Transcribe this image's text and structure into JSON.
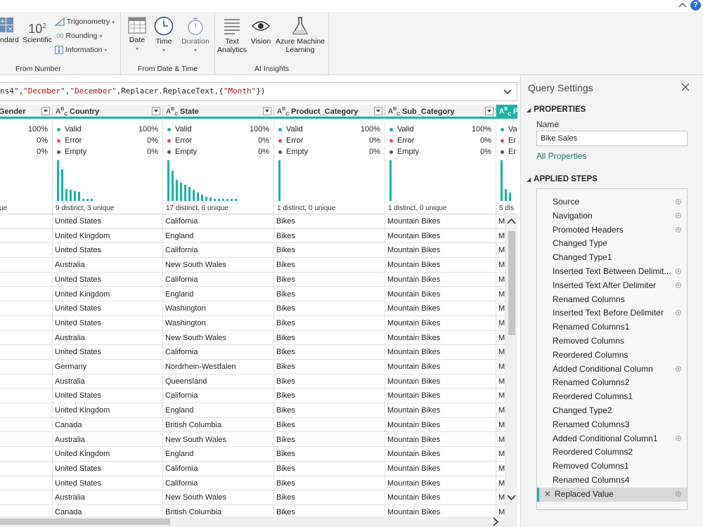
{
  "ribbon": {
    "from_number": {
      "standard_label": "ndard",
      "scientific_label": "Scientific",
      "ten_base": "10",
      "ten_exp": "2",
      "trig_label": "Trigonometry",
      "rounding_label": "Rounding",
      "information_label": "Information",
      "group_label": "From Number"
    },
    "from_date_time": {
      "date_label": "Date",
      "time_label": "Time",
      "duration_label": "Duration",
      "group_label": "From Date & Time"
    },
    "ai_insights": {
      "text_label_1": "Text",
      "text_label_2": "Analytics",
      "vision_label": "Vision",
      "azure_label_1": "Azure Machine",
      "azure_label_2": "Learning",
      "group_label": "AI Insights"
    }
  },
  "formula": {
    "prefix": "ns4\",",
    "arg1": "\"Decmber\"",
    "sep1": ",",
    "arg2": "\"December\"",
    "mid": ",Replacer.ReplaceText,{",
    "arg3": "\"Month\"",
    "suffix": "})"
  },
  "columns": [
    {
      "name": "Gender",
      "type": "ABC"
    },
    {
      "name": "Country",
      "type": "ABC"
    },
    {
      "name": "State",
      "type": "ABC"
    },
    {
      "name": "Product_Category",
      "type": "ABC"
    },
    {
      "name": "Sub_Category",
      "type": "ABC"
    },
    {
      "name": "P",
      "type": "ABC"
    }
  ],
  "profile": {
    "valid_label": "Valid",
    "error_label": "Error",
    "empty_label": "Empty",
    "col0": {
      "valid": "100%",
      "error": "0%",
      "empty": "0%",
      "distinct": "ue"
    },
    "col1": {
      "valid": "100%",
      "error": "0%",
      "empty": "0%",
      "distinct": "9 distinct, 3 unique"
    },
    "col2": {
      "valid": "100%",
      "error": "0%",
      "empty": "0%",
      "distinct": "17 distinct, 6 unique"
    },
    "col3": {
      "valid": "100%",
      "error": "0%",
      "empty": "0%",
      "distinct": "1 distinct, 0 unique"
    },
    "col4": {
      "valid": "100%",
      "error": "0%",
      "empty": "0%",
      "distinct": "1 distinct, 0 unique"
    },
    "col5": {
      "valid_short": "Va",
      "error_short": "Er",
      "empty_short": "Er",
      "distinct": "5 dis"
    },
    "hist1": [
      1.0,
      0.78,
      0.3,
      0.28,
      0.25,
      0.22,
      0.06,
      0.06,
      0.06
    ],
    "hist2": [
      1.0,
      0.75,
      0.52,
      0.45,
      0.4,
      0.35,
      0.28,
      0.2,
      0.15,
      0.1,
      0.08,
      0.06,
      0.06,
      0.06,
      0.06,
      0.06,
      0.06
    ],
    "hist3": [
      1.0
    ],
    "hist4": [
      1.0
    ],
    "hist5": [
      1.0,
      0.3,
      0.2
    ]
  },
  "rows": [
    {
      "country": "United States",
      "state": "California",
      "product": "Bikes",
      "sub": "Mountain Bikes",
      "p": "M"
    },
    {
      "country": "United Kingdom",
      "state": "England",
      "product": "Bikes",
      "sub": "Mountain Bikes",
      "p": "M"
    },
    {
      "country": " United States",
      "state": "California",
      "product": "Bikes",
      "sub": "Mountain Bikes",
      "p": "M"
    },
    {
      "country": "Australia",
      "state": "New South Wales",
      "product": "Bikes",
      "sub": "Mountain Bikes",
      "p": "M"
    },
    {
      "country": "United  States",
      "state": "California",
      "product": "Bikes",
      "sub": "Mountain Bikes",
      "p": "M"
    },
    {
      "country": "United Kingdom",
      "state": "England",
      "product": "Bikes",
      "sub": "Mountain Bikes",
      "p": "M"
    },
    {
      "country": "United States",
      "state": "Washington",
      "product": "Bikes",
      "sub": "Mountain Bikes",
      "p": "M"
    },
    {
      "country": "United States",
      "state": "Washington",
      "product": "Bikes",
      "sub": "Mountain Bikes",
      "p": "M"
    },
    {
      "country": "Australia",
      "state": "New South Wales",
      "product": "Bikes",
      "sub": "Mountain Bikes",
      "p": "M"
    },
    {
      "country": "United States",
      "state": "California",
      "product": "Bikes",
      "sub": "Mountain Bikes",
      "p": "M"
    },
    {
      "country": "Germany",
      "state": "Nordrhein-Westfalen",
      "product": "Bikes",
      "sub": "Mountain Bikes",
      "p": "M"
    },
    {
      "country": "Australia",
      "state": "Queensland",
      "product": "Bikes",
      "sub": "Mountain Bikes",
      "p": "M"
    },
    {
      "country": "United States",
      "state": "California",
      "product": "Bikes",
      "sub": "Mountain Bikes",
      "p": "M"
    },
    {
      "country": "United Kingdom",
      "state": "England",
      "product": "Bikes",
      "sub": "Mountain Bikes",
      "p": "M"
    },
    {
      "country": "Canada",
      "state": "British Columbia",
      "product": "Bikes",
      "sub": "Mountain Bikes",
      "p": "M"
    },
    {
      "country": "Australia",
      "state": "New South Wales",
      "product": "Bikes",
      "sub": "Mountain Bikes",
      "p": "M"
    },
    {
      "country": "United Kingdom",
      "state": "England",
      "product": "Bikes",
      "sub": "Mountain Bikes",
      "p": "M"
    },
    {
      "country": "United States",
      "state": "California",
      "product": "Bikes",
      "sub": "Mountain Bikes",
      "p": "M"
    },
    {
      "country": "United States",
      "state": "California",
      "product": "Bikes",
      "sub": "Mountain Bikes",
      "p": "M"
    },
    {
      "country": "Australia",
      "state": "New South Wales",
      "product": "Bikes",
      "sub": "Mountain Bikes",
      "p": "M"
    },
    {
      "country": "Canada",
      "state": "British Columbia",
      "product": "Bikes",
      "sub": "Mountain Bikes",
      "p": "M"
    }
  ],
  "query_settings": {
    "title": "Query Settings",
    "properties_label": "PROPERTIES",
    "name_label": "Name",
    "name_value": "Bike Sales",
    "all_properties_label": "All Properties",
    "applied_steps_label": "APPLIED STEPS",
    "steps": [
      {
        "label": "Source",
        "gear": true
      },
      {
        "label": "Navigation",
        "gear": true
      },
      {
        "label": "Promoted Headers",
        "gear": true
      },
      {
        "label": "Changed Type",
        "gear": false
      },
      {
        "label": "Changed Type1",
        "gear": false
      },
      {
        "label": "Inserted Text Between Delimit...",
        "gear": true
      },
      {
        "label": "Inserted Text After Delimiter",
        "gear": true
      },
      {
        "label": "Renamed Columns",
        "gear": false
      },
      {
        "label": "Inserted Text Before Delimiter",
        "gear": true
      },
      {
        "label": "Renamed Columns1",
        "gear": false
      },
      {
        "label": "Removed Columns",
        "gear": false
      },
      {
        "label": "Reordered Columns",
        "gear": false
      },
      {
        "label": "Added Conditional Column",
        "gear": true
      },
      {
        "label": "Renamed Columns2",
        "gear": false
      },
      {
        "label": "Reordered Columns1",
        "gear": false
      },
      {
        "label": "Changed Type2",
        "gear": false
      },
      {
        "label": "Renamed Columns3",
        "gear": false
      },
      {
        "label": "Added Conditional Column1",
        "gear": true
      },
      {
        "label": "Reordered Columns2",
        "gear": false
      },
      {
        "label": "Removed Columns1",
        "gear": false
      },
      {
        "label": "Renamed Columns4",
        "gear": false
      },
      {
        "label": "Replaced Value",
        "gear": true,
        "selected": true
      }
    ]
  },
  "colors": {
    "accent": "#17b3a3",
    "valid": "#17b3a3",
    "error": "#e8474d",
    "empty": "#555555",
    "link": "#1e7a6e"
  },
  "icons": {
    "collapse": "chevron-up-icon",
    "help": "help-icon",
    "formula_expand": "chevron-down-icon",
    "close": "close-icon",
    "step_settings": "gear-icon",
    "step_delete": "delete-x-icon"
  }
}
